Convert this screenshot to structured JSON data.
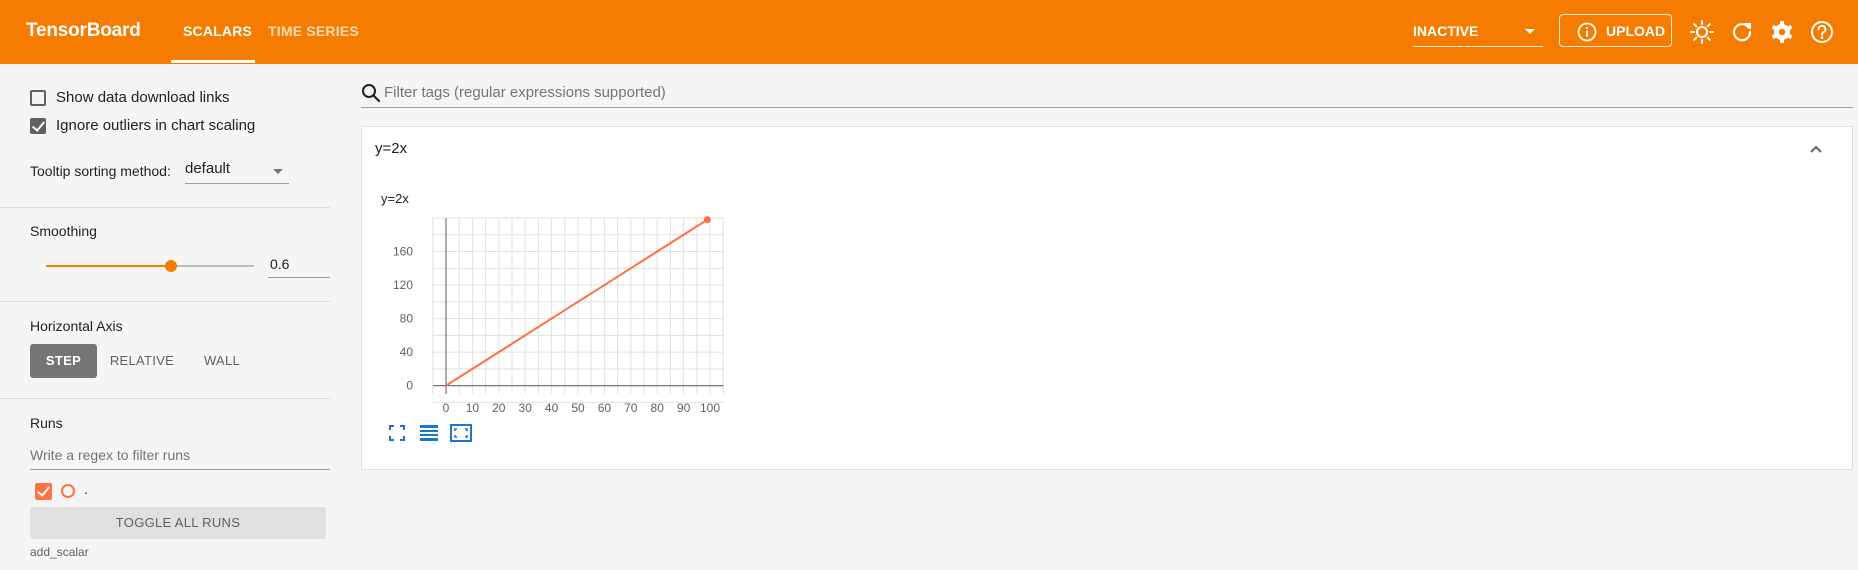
{
  "header": {
    "brand": "TensorBoard",
    "tabs": [
      {
        "label": "SCALARS",
        "active": true
      },
      {
        "label": "TIME SERIES",
        "active": false
      }
    ],
    "run_status": "INACTIVE",
    "upload_label": "UPLOAD",
    "icons": [
      "info-icon",
      "brightness-icon",
      "refresh-icon",
      "settings-icon",
      "help-icon"
    ],
    "colors": {
      "bar": "#f57c00",
      "text": "#ffffff"
    }
  },
  "sidebar": {
    "show_download_links": {
      "label": "Show data download links",
      "checked": false
    },
    "ignore_outliers": {
      "label": "Ignore outliers in chart scaling",
      "checked": true
    },
    "tooltip": {
      "label": "Tooltip sorting method:",
      "value": "default"
    },
    "smoothing": {
      "label": "Smoothing",
      "value": "0.6",
      "level": 0.6
    },
    "horizontal_axis": {
      "label": "Horizontal Axis",
      "options": [
        "STEP",
        "RELATIVE",
        "WALL"
      ],
      "selected": "STEP"
    },
    "runs": {
      "label": "Runs",
      "filter_placeholder": "Write a regex to filter runs",
      "items": [
        {
          "name": ".",
          "checked": true,
          "color": "#ff7043"
        }
      ],
      "toggle_label": "TOGGLE ALL RUNS",
      "footer": "add_scalar"
    }
  },
  "main": {
    "filter_placeholder": "Filter tags (regular expressions supported)",
    "card": {
      "title": "y=2x",
      "chart_title": "y=2x",
      "controls": [
        "fullscreen-icon",
        "data-table-icon",
        "fit-domain-icon"
      ]
    }
  },
  "chart_data": {
    "type": "line",
    "title": "y=2x",
    "xlabel": "",
    "ylabel": "",
    "xlim": [
      0,
      100
    ],
    "ylim": [
      -10,
      200
    ],
    "x_ticks": [
      0,
      10,
      20,
      30,
      40,
      50,
      60,
      70,
      80,
      90,
      100
    ],
    "y_ticks": [
      0,
      40,
      80,
      120,
      160
    ],
    "grid": true,
    "series": [
      {
        "color": "#ff7043",
        "x": [
          0,
          10,
          20,
          30,
          40,
          50,
          60,
          70,
          80,
          90,
          99
        ],
        "y": [
          0,
          20,
          40,
          60,
          80,
          100,
          120,
          140,
          160,
          180,
          198
        ]
      }
    ]
  }
}
